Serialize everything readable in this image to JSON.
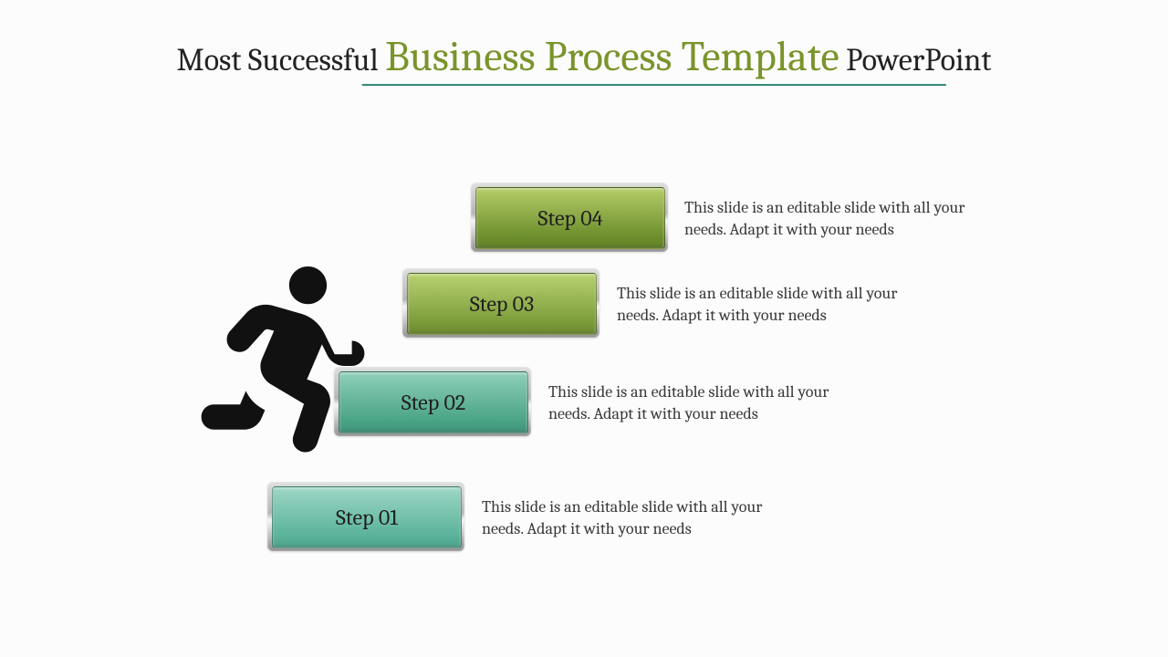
{
  "title": {
    "prefix": "Most Successful ",
    "highlight": "Business Process Template",
    "suffix": " PowerPoint"
  },
  "colors": {
    "highlight": "#7a942c",
    "underline": "#2f8a77",
    "step4": "#6e8f2d",
    "step3": "#7c9c3a",
    "step2": "#4aa486",
    "step1": "#5bb39b"
  },
  "steps": [
    {
      "label": "Step 04",
      "desc": "This slide is an editable slide with all your needs. Adapt it with your needs"
    },
    {
      "label": "Step 03",
      "desc": "This slide is an editable slide with all your needs. Adapt it with your needs"
    },
    {
      "label": "Step 02",
      "desc": "This slide is an editable slide with all your needs. Adapt it with your needs"
    },
    {
      "label": "Step 01",
      "desc": "This slide is an editable slide with all your needs. Adapt it with your needs"
    }
  ],
  "icon": "running-person-icon"
}
